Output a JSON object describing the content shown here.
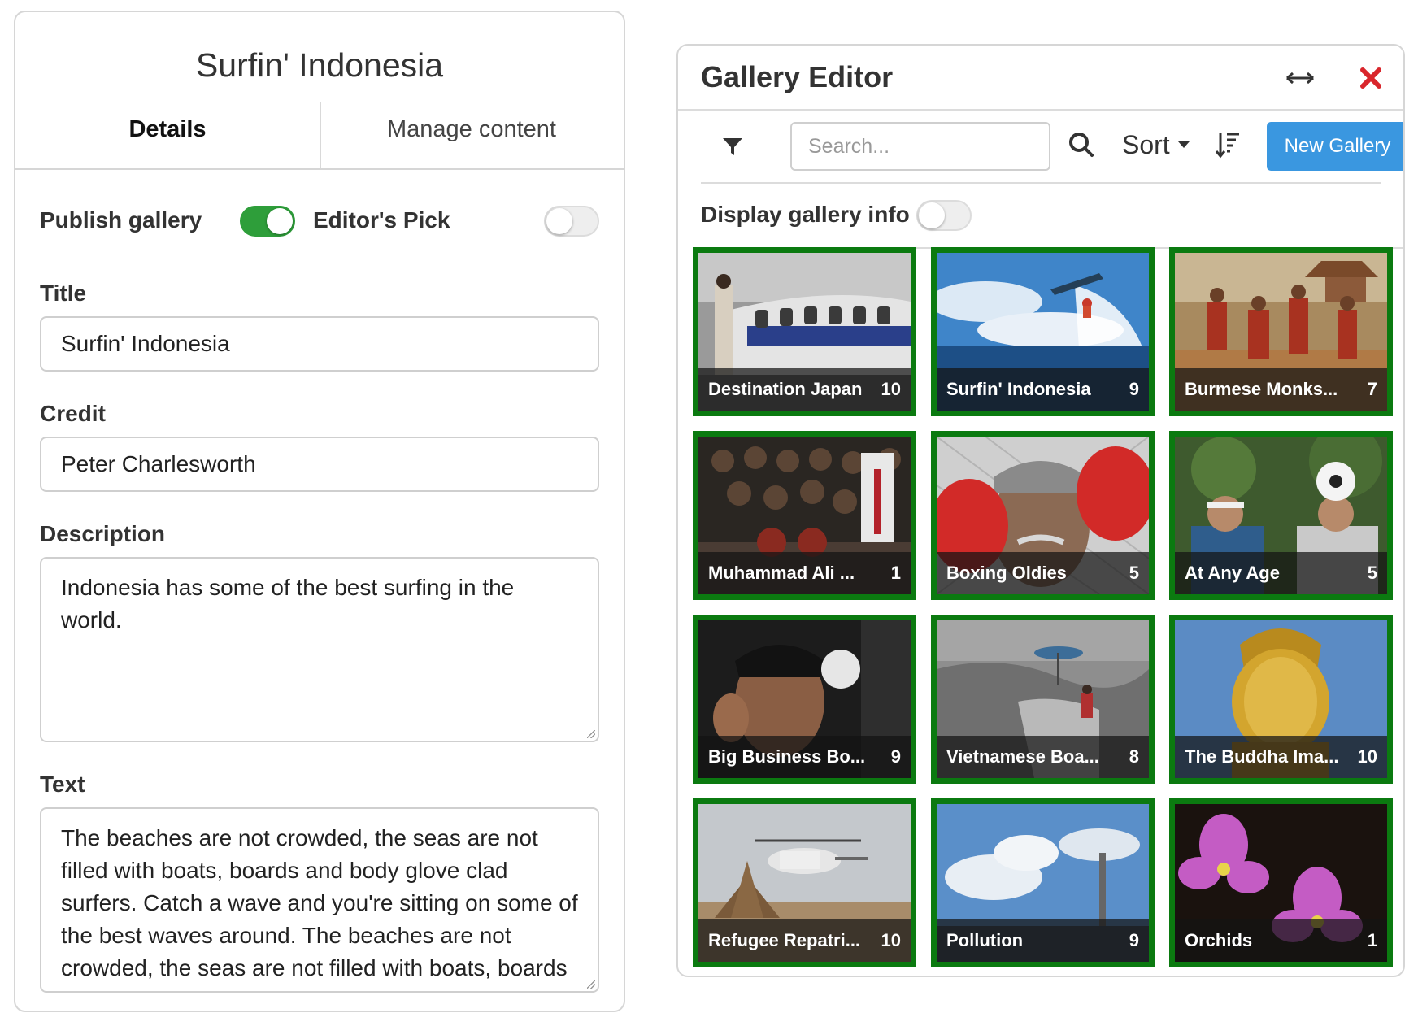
{
  "left_panel": {
    "title": "Surfin' Indonesia",
    "tabs": [
      {
        "label": "Details",
        "active": true
      },
      {
        "label": "Manage content",
        "active": false
      }
    ],
    "toggles": [
      {
        "label": "Publish gallery",
        "on": true
      },
      {
        "label": "Editor's Pick",
        "on": false
      }
    ],
    "fields": {
      "title": {
        "label": "Title",
        "value": "Surfin' Indonesia"
      },
      "credit": {
        "label": "Credit",
        "value": "Peter Charlesworth"
      },
      "description": {
        "label": "Description",
        "value": "Indonesia has some of the best surfing in the world."
      },
      "text": {
        "label": "Text",
        "value": "The beaches are not crowded, the seas are not filled with boats, boards and body glove clad surfers. Catch a wave and you're sitting on some of the best waves around. The beaches are not crowded, the seas are not filled with boats, boards and body glove clad surfers. Catch a wave and you're"
      }
    }
  },
  "gallery_editor": {
    "title": "Gallery Editor",
    "search_placeholder": "Search...",
    "sort_label": "Sort",
    "new_gallery_label": "New Gallery",
    "display_info_label": "Display gallery info",
    "display_info_on": false,
    "accent_color": "#3a97e0",
    "close_color": "#d9262c",
    "tile_border_color": "#0b7a10",
    "galleries": [
      {
        "name": "Destination Japan",
        "count": "10"
      },
      {
        "name": "Surfin' Indonesia",
        "count": "9"
      },
      {
        "name": "Burmese Monks...",
        "count": "7"
      },
      {
        "name": "Muhammad Ali ...",
        "count": "1"
      },
      {
        "name": "Boxing Oldies",
        "count": "5"
      },
      {
        "name": "At Any Age",
        "count": "5"
      },
      {
        "name": "Big Business Bo...",
        "count": "9"
      },
      {
        "name": "Vietnamese Boa...",
        "count": "8"
      },
      {
        "name": "The Buddha Ima...",
        "count": "10"
      },
      {
        "name": "Refugee Repatri...",
        "count": "10"
      },
      {
        "name": "Pollution",
        "count": "9"
      },
      {
        "name": "Orchids",
        "count": "1"
      }
    ]
  }
}
